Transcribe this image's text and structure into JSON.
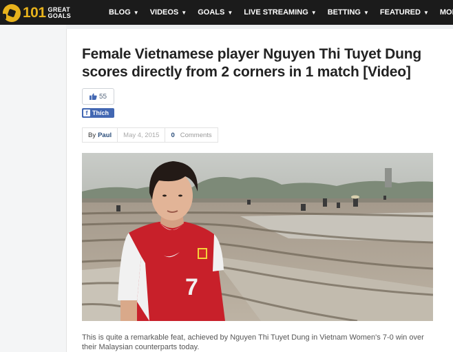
{
  "logo": {
    "number": "101",
    "line1": "GREAT",
    "line2": "GOALS"
  },
  "nav": [
    {
      "label": "BLOG",
      "caret": "▼"
    },
    {
      "label": "VIDEOS",
      "caret": "▼"
    },
    {
      "label": "GOALS",
      "caret": "▼"
    },
    {
      "label": "LIVE STREAMING",
      "caret": "▼"
    },
    {
      "label": "BETTING",
      "caret": "▼"
    },
    {
      "label": "FEATURED",
      "caret": "▼"
    },
    {
      "label": "MOR",
      "caret": ""
    }
  ],
  "article": {
    "title": "Female Vietnamese player Nguyen Thi Tuyet Dung scores directly from 2 corners in 1 match [Video]",
    "like_count": "55",
    "fb_label": "Thích",
    "by_prefix": "By",
    "author": "Paul",
    "date": "May 4, 2015",
    "comment_count": "0",
    "comments_label": "Comments",
    "jersey_number": "7",
    "caption": "This is quite a remarkable feat, achieved by Nguyen Thi Tuyet Dung in Vietnam Women's 7-0 win over their Malaysian counterparts today."
  },
  "colors": {
    "topbar": "#1b1b1b",
    "logo_gold": "#e7b21c",
    "facebook": "#4267b2",
    "jersey_red": "#c8202a"
  }
}
